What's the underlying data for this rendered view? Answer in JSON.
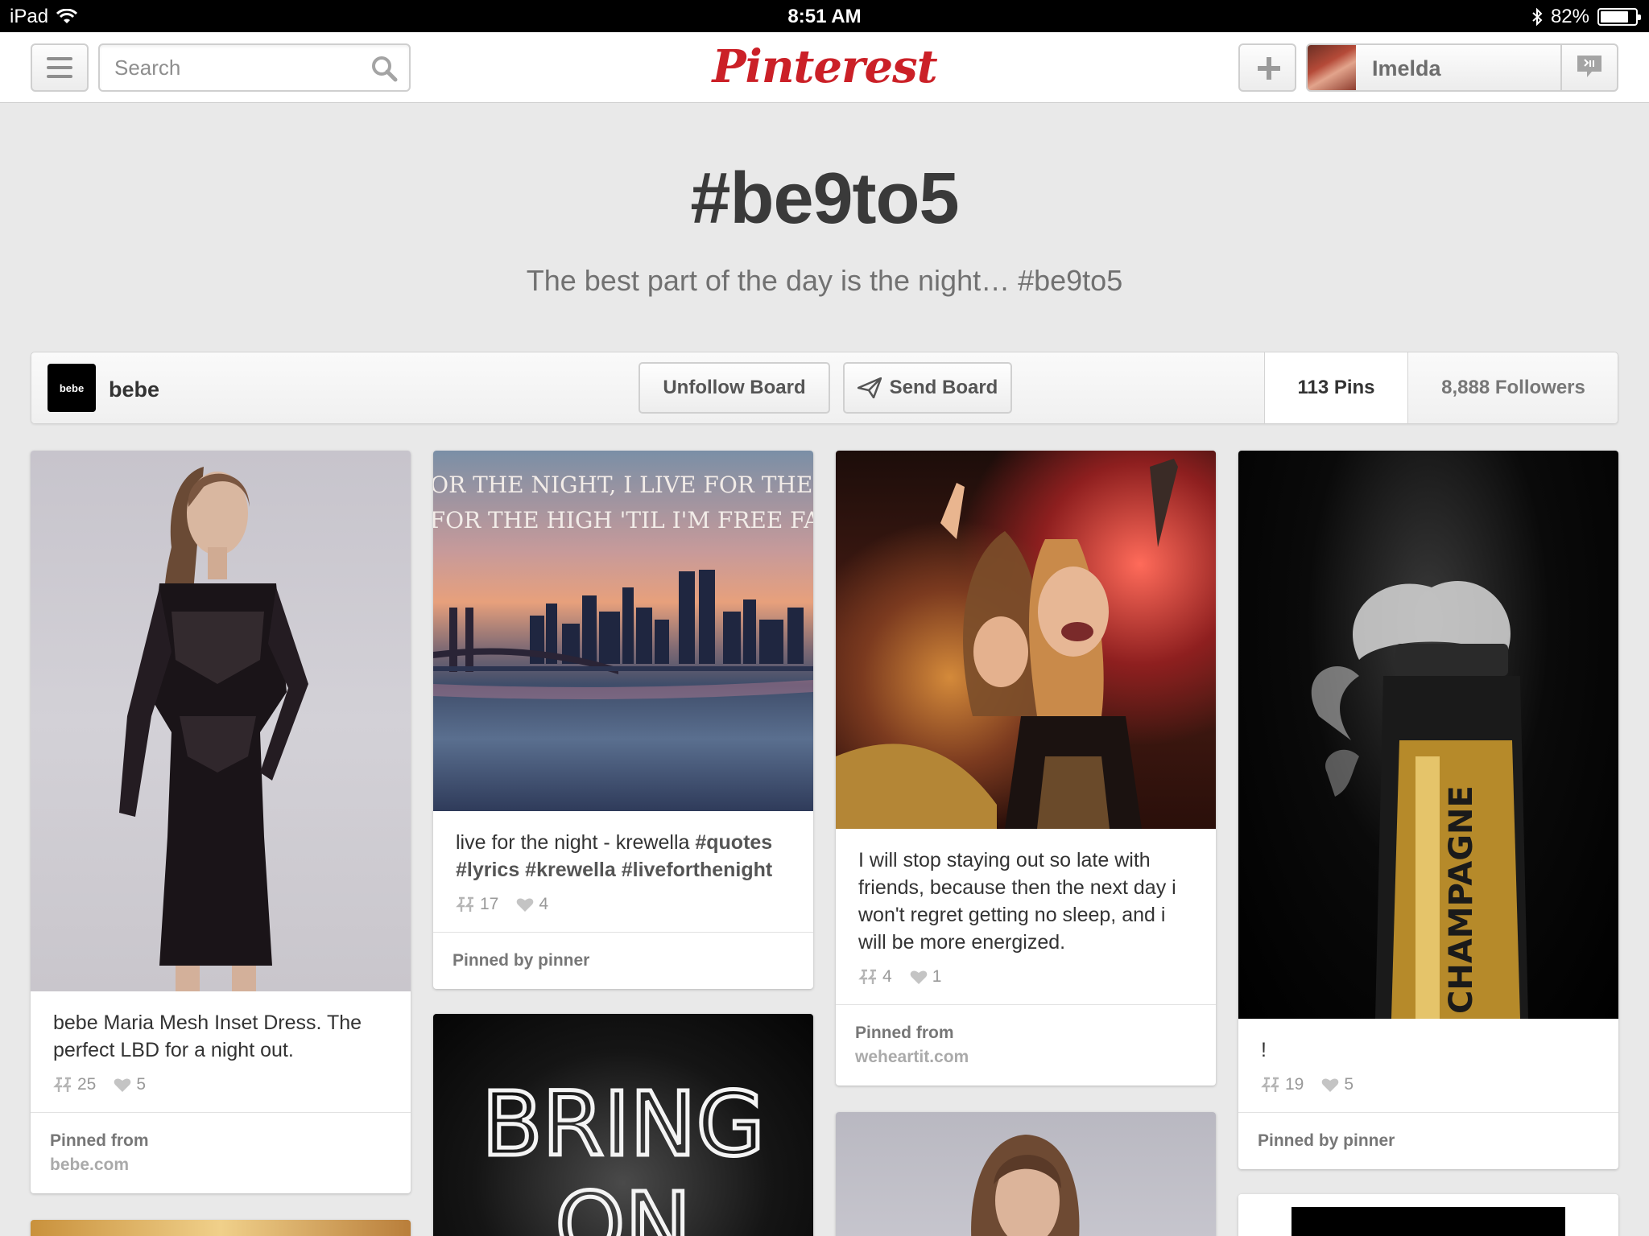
{
  "status_bar": {
    "device": "iPad",
    "time": "8:51 AM",
    "battery_text": "82%",
    "battery_level": 0.82
  },
  "nav": {
    "search_placeholder": "Search",
    "logo": "Pinterest",
    "user_name": "Imelda"
  },
  "board": {
    "title": "#be9to5",
    "description": "The best part of the day is the night… #be9to5",
    "owner_logo_text": "bebe",
    "owner_name": "bebe",
    "unfollow_label": "Unfollow Board",
    "send_label": "Send Board",
    "pins_count": "113 Pins",
    "followers_count": "8,888 Followers"
  },
  "pins": [
    {
      "desc": "bebe Maria Mesh Inset Dress. The perfect LBD for a night out.",
      "repins": "25",
      "likes": "5",
      "footer_label": "Pinned from",
      "footer_source": "bebe.com"
    },
    {
      "desc": "live for the night - krewella",
      "tags": "#quotes #lyrics #krewella #liveforthenight",
      "image_text_line1": "I LIVE FOR THE NIGHT, I LIVE FOR THE LIGHTS",
      "image_text_line2": "I LIVE FOR THE HIGH 'TIL I'M FREE FALLING",
      "repins": "17",
      "likes": "4",
      "footer_label": "Pinned by pinner"
    },
    {
      "desc": "I will stop staying out so late with friends, because then the next day i won't regret getting no sleep, and i will be more energized.",
      "repins": "4",
      "likes": "1",
      "footer_label": "Pinned from",
      "footer_source": "weheartit.com"
    },
    {
      "desc": "!",
      "image_text": "CHAMPAGNE",
      "repins": "19",
      "likes": "5",
      "footer_label": "Pinned by pinner"
    },
    {
      "image_text_line1": "BRING",
      "image_text_line2": "ON"
    },
    {},
    {},
    {}
  ]
}
